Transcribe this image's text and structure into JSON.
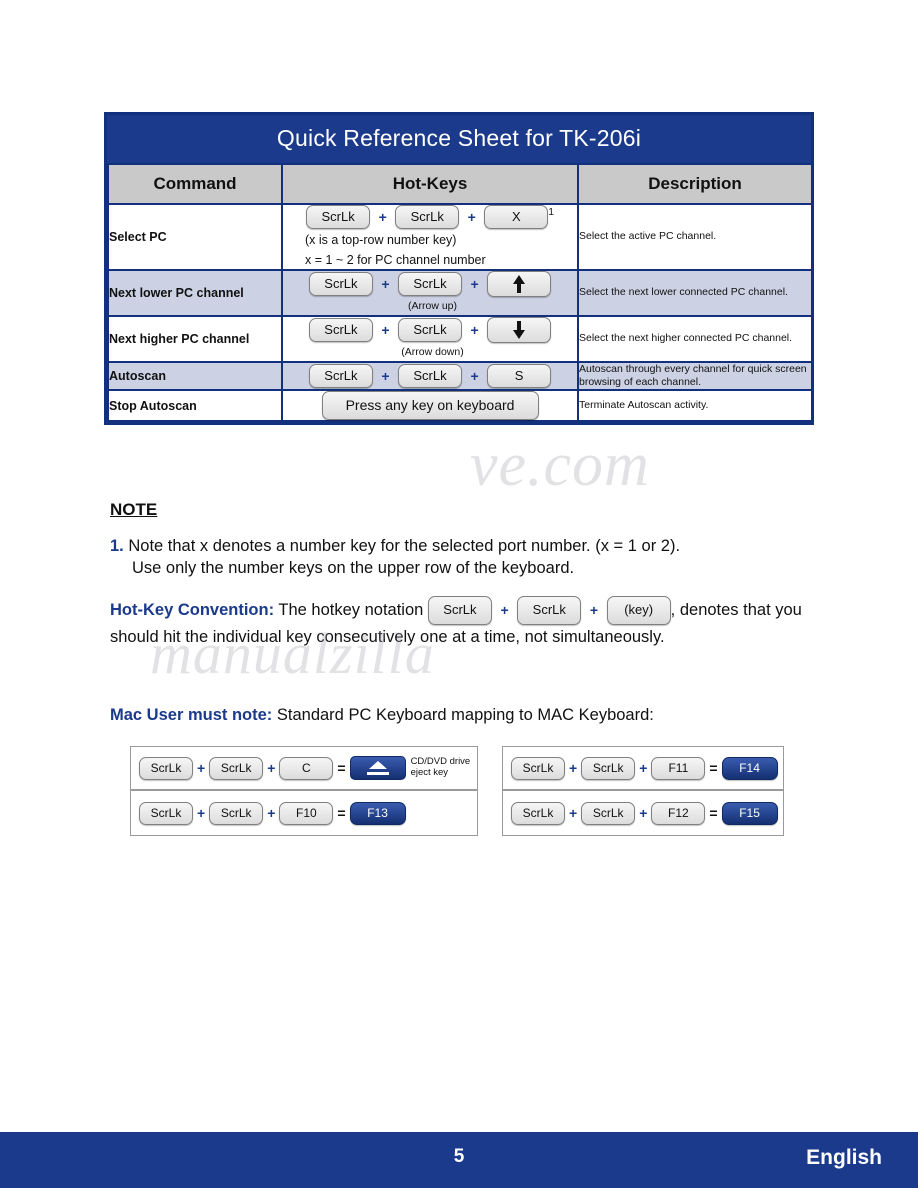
{
  "table": {
    "title": "Quick Reference Sheet for TK-206i",
    "headers": [
      "Command",
      "Hot-Keys",
      "Description"
    ],
    "rows": [
      {
        "command": "Select PC",
        "keys": [
          "ScrLk",
          "ScrLk",
          "X"
        ],
        "superscript": "1",
        "subnote_line1": "(x is a top-row number key)",
        "subnote_line2": "x = 1 ~ 2 for PC channel number",
        "description": "Select the active PC channel."
      },
      {
        "command": "Next lower PC channel",
        "keys": [
          "ScrLk",
          "ScrLk",
          "arrow-up"
        ],
        "arrow_label": "(Arrow up)",
        "description": "Select the next lower connected PC channel."
      },
      {
        "command": "Next higher PC channel",
        "keys": [
          "ScrLk",
          "ScrLk",
          "arrow-down"
        ],
        "arrow_label": "(Arrow down)",
        "description": "Select the next higher connected PC channel."
      },
      {
        "command": "Autoscan",
        "keys": [
          "ScrLk",
          "ScrLk",
          "S"
        ],
        "description": "Autoscan through every channel for quick screen browsing of each channel."
      },
      {
        "command": "Stop Autoscan",
        "keys": [
          "Press any key on keyboard"
        ],
        "description": "Terminate Autoscan activity."
      }
    ],
    "plus": "+",
    "equals": "="
  },
  "note": {
    "heading": "NOTE",
    "number": "1.",
    "line1": "Note that x denotes a number key for the selected port number. (x = 1 or 2).",
    "line2": "Use only the number keys on the upper row of the keyboard."
  },
  "convention": {
    "lead": "Hot-Key Convention:",
    "text_before": "The hotkey notation",
    "keys": [
      "ScrLk",
      "ScrLk",
      "(key)"
    ],
    "comma": ",",
    "text_after": "denotes that you should hit the individual key consecutively one at a time, not simultaneously."
  },
  "mac": {
    "lead": "Mac User must note:",
    "text": "Standard PC Keyboard mapping to MAC Keyboard:",
    "mappings": [
      {
        "keys": [
          "ScrLk",
          "ScrLk",
          "C"
        ],
        "result": "eject-icon",
        "result_label_line1": "CD/DVD drive",
        "result_label_line2": "eject key"
      },
      {
        "keys": [
          "ScrLk",
          "ScrLk",
          "F10"
        ],
        "result": "F13"
      },
      {
        "keys": [
          "ScrLk",
          "ScrLk",
          "F11"
        ],
        "result": "F14"
      },
      {
        "keys": [
          "ScrLk",
          "ScrLk",
          "F12"
        ],
        "result": "F15"
      }
    ]
  },
  "watermark": {
    "line1": "ve.com",
    "line2": "manualzilla"
  },
  "footer": {
    "page": "5",
    "language": "English"
  },
  "colors": {
    "brand_blue": "#1b3a8c",
    "header_gray": "#c9c9c9",
    "row_shade": "#ccd2e4"
  }
}
